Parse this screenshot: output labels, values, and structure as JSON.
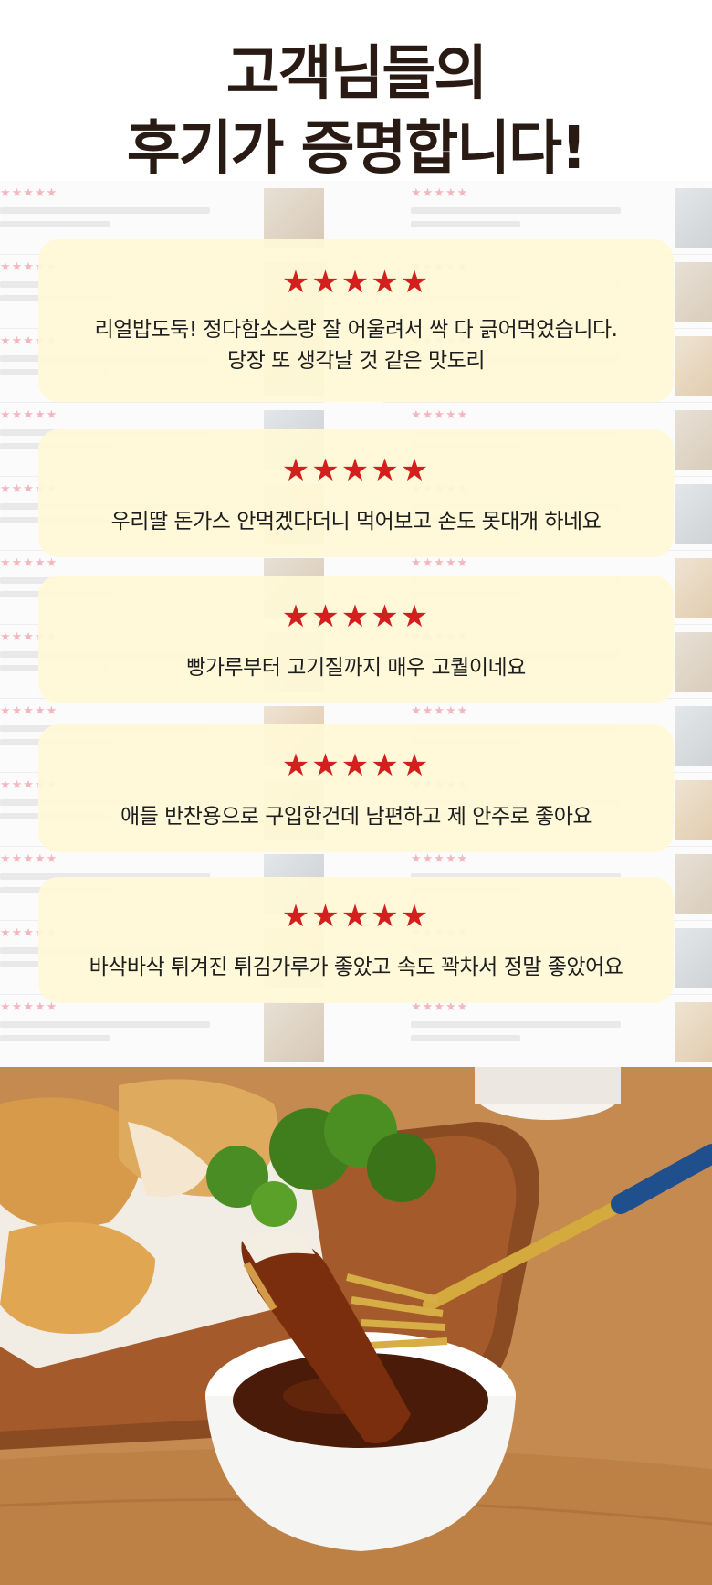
{
  "headline": {
    "line1": "고객님들의",
    "line2": "후기가 증명합니다!"
  },
  "reviews": [
    {
      "stars": "★★★★★",
      "line1": "리얼밥도둑! 정다함소스랑 잘 어울려서 싹 다 긁어먹었습니다.",
      "line2": "당장 또 생각날 것 같은 맛도리"
    },
    {
      "stars": "★★★★★",
      "line1": "우리딸 돈가스 안먹겠다더니 먹어보고 손도 못대개 하네요"
    },
    {
      "stars": "★★★★★",
      "line1": "빵가루부터 고기질까지 매우 고퀄이네요"
    },
    {
      "stars": "★★★★★",
      "line1": "애들 반찬용으로 구입한건데 남편하고 제 안주로 좋아요"
    },
    {
      "stars": "★★★★★",
      "line1": "바삭바삭 튀겨진 튀김가루가 좋았고 속도 꽉차서 정말 좋았어요"
    }
  ],
  "colors": {
    "star_red": "#d3201f",
    "card_bg": "#fff9d6",
    "headline": "#2a1a14"
  }
}
